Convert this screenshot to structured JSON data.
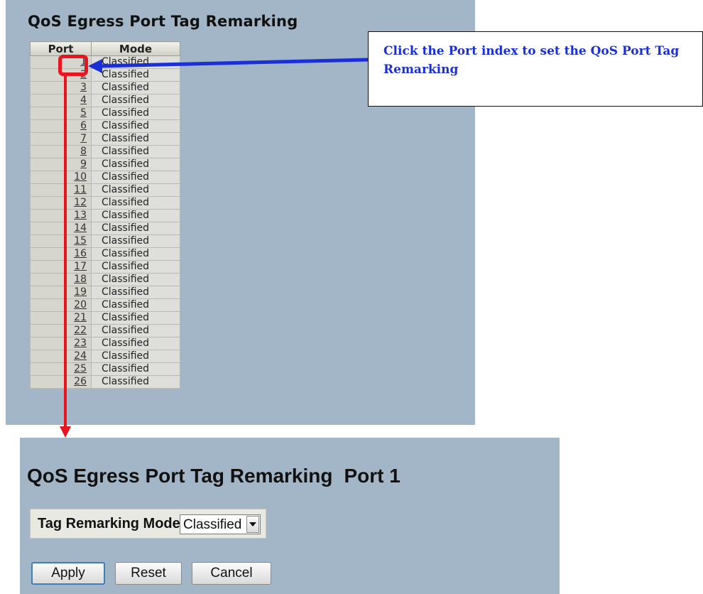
{
  "list_page": {
    "title": "QoS Egress Port Tag Remarking",
    "columns": [
      "Port",
      "Mode"
    ],
    "rows": [
      {
        "port": "1",
        "mode": "Classified"
      },
      {
        "port": "2",
        "mode": "Classified"
      },
      {
        "port": "3",
        "mode": "Classified"
      },
      {
        "port": "4",
        "mode": "Classified"
      },
      {
        "port": "5",
        "mode": "Classified"
      },
      {
        "port": "6",
        "mode": "Classified"
      },
      {
        "port": "7",
        "mode": "Classified"
      },
      {
        "port": "8",
        "mode": "Classified"
      },
      {
        "port": "9",
        "mode": "Classified"
      },
      {
        "port": "10",
        "mode": "Classified"
      },
      {
        "port": "11",
        "mode": "Classified"
      },
      {
        "port": "12",
        "mode": "Classified"
      },
      {
        "port": "13",
        "mode": "Classified"
      },
      {
        "port": "14",
        "mode": "Classified"
      },
      {
        "port": "15",
        "mode": "Classified"
      },
      {
        "port": "16",
        "mode": "Classified"
      },
      {
        "port": "17",
        "mode": "Classified"
      },
      {
        "port": "18",
        "mode": "Classified"
      },
      {
        "port": "19",
        "mode": "Classified"
      },
      {
        "port": "20",
        "mode": "Classified"
      },
      {
        "port": "21",
        "mode": "Classified"
      },
      {
        "port": "22",
        "mode": "Classified"
      },
      {
        "port": "23",
        "mode": "Classified"
      },
      {
        "port": "24",
        "mode": "Classified"
      },
      {
        "port": "25",
        "mode": "Classified"
      },
      {
        "port": "26",
        "mode": "Classified"
      }
    ]
  },
  "callout": {
    "text": "Click the Port index to set the QoS Port Tag Remarking"
  },
  "detail_page": {
    "title": "QoS Egress Port Tag Remarking",
    "port_suffix": "Port 1",
    "mode_label": "Tag Remarking Mode",
    "mode_value": "Classified",
    "buttons": {
      "apply": "Apply",
      "reset": "Reset",
      "cancel": "Cancel"
    }
  },
  "colors": {
    "panel_bg": "#a3b6c8",
    "highlight_red": "#e8141e",
    "callout_blue": "#1a2fd6"
  },
  "icons": {
    "select_arrow": "chevron-down-icon",
    "blue_arrow": "arrow-left-icon",
    "red_arrow": "arrow-down-icon"
  }
}
